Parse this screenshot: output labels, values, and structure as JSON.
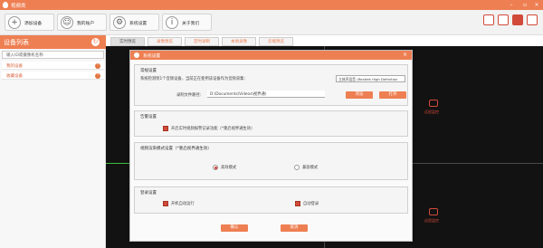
{
  "app": {
    "title": "视频类"
  },
  "toolbar": {
    "add_device": "添加设备",
    "my_account": "我的账户",
    "system_settings": "系统设置",
    "about": "关于我们"
  },
  "left_panel": {
    "title": "设备列表",
    "search_placeholder": "输入ID或摄像机名称",
    "items": [
      {
        "label": "我的设备"
      },
      {
        "label": "收藏设备"
      }
    ]
  },
  "tabs": [
    "实时预览",
    "录像预览",
    "定时录制",
    "本地录像",
    "云端预览"
  ],
  "video_cells": {
    "cam_label": "远程监控"
  },
  "dialog": {
    "title": "系统设置",
    "general": {
      "title": "常规设置",
      "desc": "系统检测到1个音频设备，当前正在使用该设备作为音频采集：",
      "audio_device": "立体声混音 (Realtek High Definition",
      "path_label": "录制文件路径：",
      "path_value": "D:\\Documents\\Videos\\视界通\\",
      "browse_btn": "浏览",
      "open_btn": "打开"
    },
    "alarm": {
      "title": "告警设置",
      "checkbox_label": "开启实时视频报警记录功能（*重启视界通生效）"
    },
    "mode": {
      "title": "视频渲染模式设置（*重启视界通生效）",
      "option_a": "高效模式",
      "option_b": "兼容模式"
    },
    "startup": {
      "title": "登录设置",
      "auto_run": "开机自动运行",
      "auto_login": "自动登录"
    },
    "ok_btn": "确认",
    "cancel_btn": "取消"
  },
  "colors": {
    "accent": "#ee7f52",
    "dark_red": "#d24a3a",
    "video_bg": "#121212"
  }
}
